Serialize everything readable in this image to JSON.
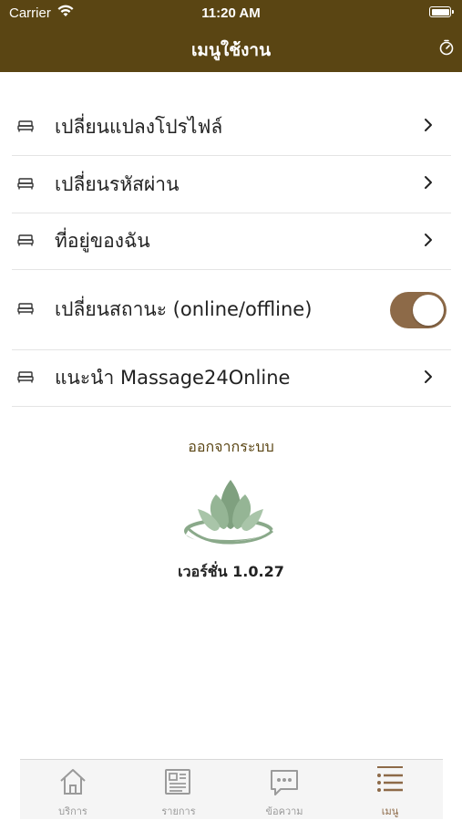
{
  "status_bar": {
    "carrier": "Carrier",
    "time": "11:20 AM",
    "battery_level": 1.0
  },
  "header": {
    "title": "เมนูใช้งาน",
    "timer_icon": "timer-icon"
  },
  "menu": {
    "items": [
      {
        "label": "เปลี่ยนแปลงโปรไฟล์",
        "icon": "bed-icon",
        "control": "chevron"
      },
      {
        "label": "เปลี่ยนรหัสผ่าน",
        "icon": "bed-icon",
        "control": "chevron"
      },
      {
        "label": "ที่อยู่ของฉัน",
        "icon": "bed-icon",
        "control": "chevron"
      },
      {
        "label": "เปลี่ยนสถานะ (online/offline)",
        "icon": "bed-icon",
        "control": "toggle",
        "toggle_on": true
      },
      {
        "label": "แนะนำ Massage24Online",
        "icon": "bed-icon",
        "control": "chevron"
      }
    ]
  },
  "logout_label": "ออกจากระบบ",
  "logo": {
    "name": "lotus-logo",
    "color": "#8aa98a"
  },
  "version_label": "เวอร์ชั่น 1.0.27",
  "tabbar": {
    "tabs": [
      {
        "label": "บริการ",
        "icon": "home-icon",
        "active": false
      },
      {
        "label": "รายการ",
        "icon": "newspaper-icon",
        "active": false
      },
      {
        "label": "ข้อความ",
        "icon": "chat-bubble-icon",
        "active": false
      },
      {
        "label": "เมนู",
        "icon": "list-menu-icon",
        "active": true
      }
    ]
  },
  "colors": {
    "header_bg": "#5a4513",
    "accent": "#8d6a48",
    "logout_text": "#5a4513",
    "inactive_tab": "#9a9a9a"
  }
}
